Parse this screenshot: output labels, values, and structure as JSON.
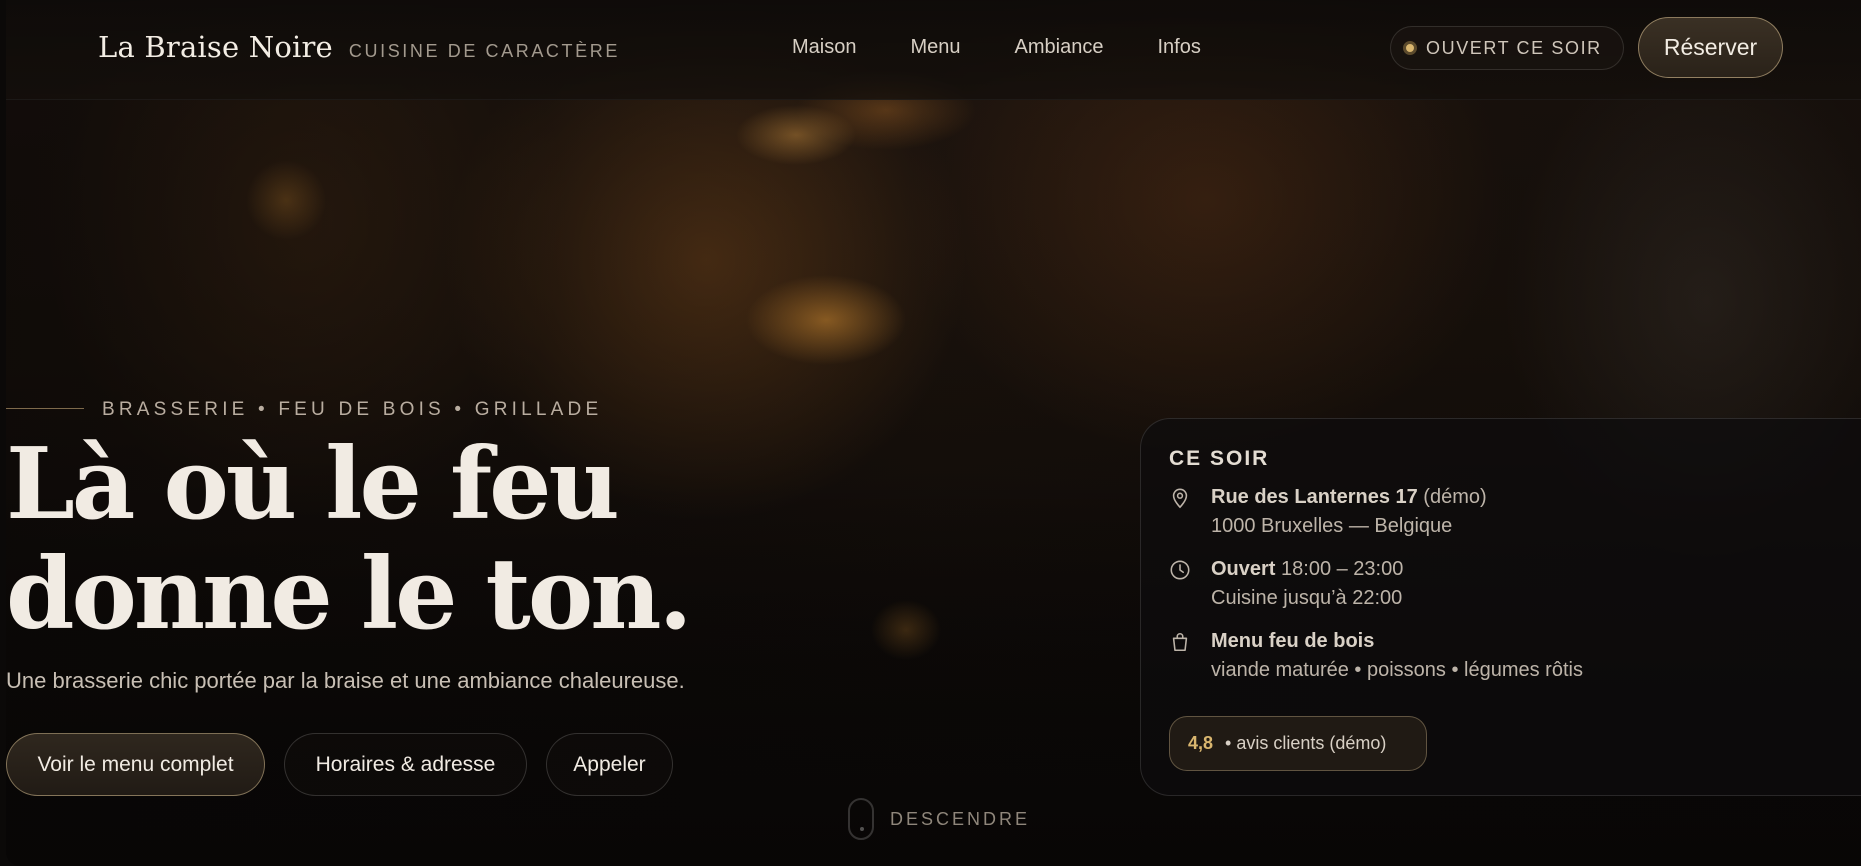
{
  "brand": {
    "name": "La Braise Noire",
    "tagline": "CUISINE DE CARACTÈRE"
  },
  "nav": {
    "items": [
      "Maison",
      "Menu",
      "Ambiance",
      "Infos"
    ]
  },
  "status": {
    "label": "OUVERT CE SOIR",
    "dot_color": "#d9b66f"
  },
  "reserve": {
    "label": "Réserver"
  },
  "hero": {
    "eyebrow": "BRASSERIE • FEU DE BOIS • GRILLADE",
    "title": "Là où le feu donne le ton.",
    "subtitle": "Une brasserie chic portée par la braise et une ambiance chaleureuse.",
    "cta": {
      "primary": "Voir le menu complet",
      "secondary": "Horaires & adresse",
      "tertiary": "Appeler"
    },
    "scroll_label": "DESCENDRE"
  },
  "card": {
    "title": "CE SOIR",
    "address": {
      "icon": "location-pin-icon",
      "bold": "Rue des Lanternes 17",
      "suffix": " (démo)",
      "line2": "1000 Bruxelles — Belgique"
    },
    "hours": {
      "icon": "clock-icon",
      "bold": "Ouvert",
      "suffix": " 18:00 – 23:00",
      "line2": "Cuisine jusqu’à 22:00"
    },
    "menu": {
      "icon": "shopping-bag-icon",
      "bold": "Menu feu de bois",
      "line2": "viande maturée • poissons • légumes rôtis"
    },
    "rating": {
      "value": "4,8",
      "label": "• avis clients (démo)"
    }
  },
  "colors": {
    "accent": "#d9b66f",
    "background": "#0b0908",
    "text": "#efe9e1"
  }
}
